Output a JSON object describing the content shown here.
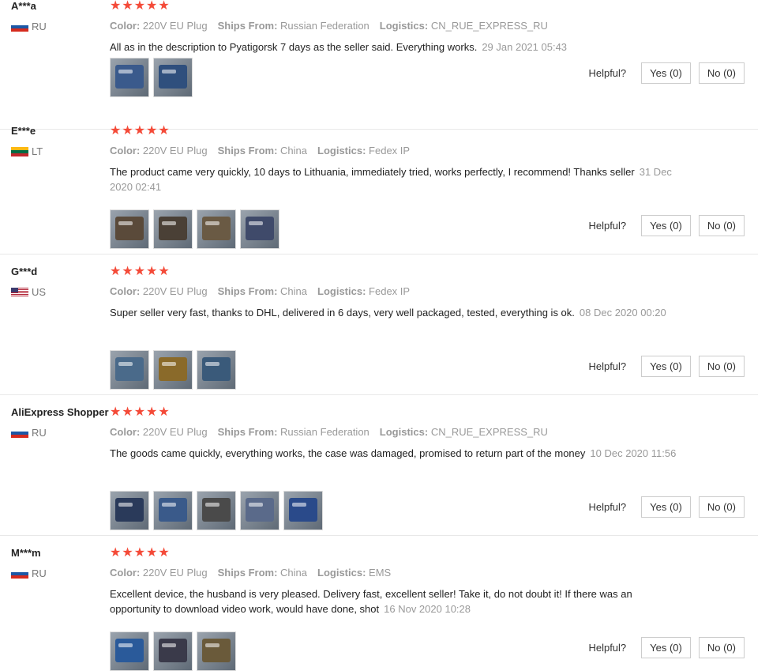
{
  "labels": {
    "color": "Color:",
    "ships_from": "Ships From:",
    "logistics": "Logistics:",
    "helpful": "Helpful?"
  },
  "stars_glyph": "★★★★★",
  "reviews": [
    {
      "name": "A***a",
      "country": "RU",
      "flag": "russia-flag-icon",
      "rating": 5,
      "color": "220V EU Plug",
      "ships_from": "Russian Federation",
      "logistics": "CN_RUE_EXPRESS_RU",
      "text": "All as in the description to Pyatigorsk 7 days as the seller said. Everything works.",
      "date": "29 Jan 2021 05:43",
      "images": [
        "#3a5a8c",
        "#2f4f7d"
      ],
      "yes": "Yes (0)",
      "no": "No (0)"
    },
    {
      "name": "E***e",
      "country": "LT",
      "flag": "lithuania-flag-icon",
      "rating": 5,
      "color": "220V EU Plug",
      "ships_from": "China",
      "logistics": "Fedex IP",
      "text": "The product came very quickly, 10 days to Lithuania, immediately tried, works perfectly, I recommend! Thanks seller",
      "date": "31 Dec 2020 02:41",
      "images": [
        "#5a4a3a",
        "#4a4036",
        "#6a5a44",
        "#3f4a6a"
      ],
      "yes": "Yes (0)",
      "no": "No (0)"
    },
    {
      "name": "G***d",
      "country": "US",
      "flag": "usa-flag-icon",
      "rating": 5,
      "color": "220V EU Plug",
      "ships_from": "China",
      "logistics": "Fedex IP",
      "text": "Super seller very fast, thanks to DHL, delivered in 6 days, very well packaged, tested, everything is ok.",
      "date": "08 Dec 2020 00:20",
      "images": [
        "#4a6a8a",
        "#8a6a2a",
        "#3a5a7a"
      ],
      "yes": "Yes (0)",
      "no": "No (0)"
    },
    {
      "name": "AliExpress Shopper",
      "country": "RU",
      "flag": "russia-flag-icon",
      "rating": 5,
      "color": "220V EU Plug",
      "ships_from": "Russian Federation",
      "logistics": "CN_RUE_EXPRESS_RU",
      "text": "The goods came quickly, everything works, the case was damaged, promised to return part of the money",
      "date": "10 Dec 2020 11:56",
      "images": [
        "#2a3a5a",
        "#3a5a8a",
        "#4a4a4a",
        "#5a6a8a",
        "#2a4a8a"
      ],
      "yes": "Yes (0)",
      "no": "No (0)"
    },
    {
      "name": "M***m",
      "country": "RU",
      "flag": "russia-flag-icon",
      "rating": 5,
      "color": "220V EU Plug",
      "ships_from": "China",
      "logistics": "EMS",
      "text": "Excellent device, the husband is very pleased. Delivery fast, excellent seller! Take it, do not doubt it! If there was an opportunity to download video work, would have done, shot",
      "date": "16 Nov 2020 10:28",
      "images": [
        "#2a5a9a",
        "#3a3a4a",
        "#6a5a3a"
      ],
      "yes": "Yes (0)",
      "no": "No (0)"
    }
  ]
}
